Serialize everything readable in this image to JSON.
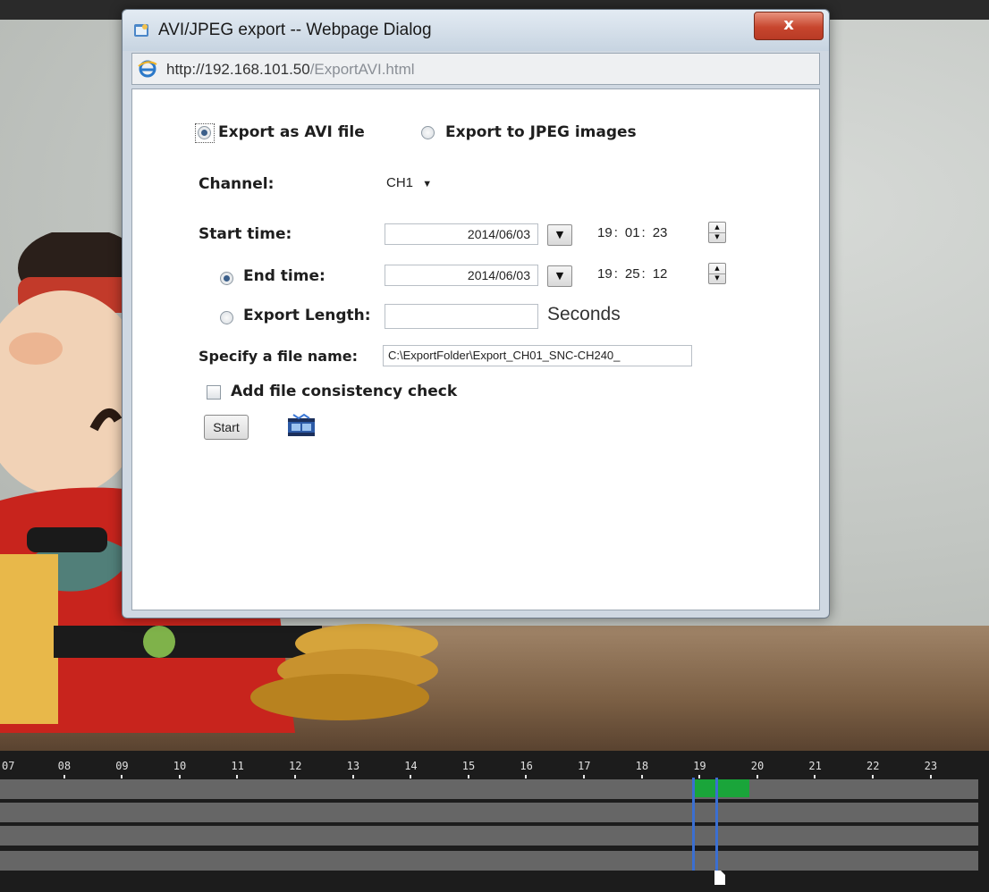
{
  "dialog": {
    "title": "AVI/JPEG export -- Webpage Dialog",
    "close_label": "x",
    "address": {
      "host": "http://192.168.101.50",
      "path": "/ExportAVI.html"
    }
  },
  "form": {
    "export_avi_label": "Export as AVI file",
    "export_jpeg_label": "Export to JPEG images",
    "export_mode": "avi",
    "channel_label": "Channel:",
    "channel_value": "CH1",
    "start_label": "Start time:",
    "start_date": "2014/06/03",
    "start_h": "19",
    "start_m": "01",
    "start_s": "23",
    "end_label": "End time:",
    "end_date": "2014/06/03",
    "end_h": "19",
    "end_m": "25",
    "end_s": "12",
    "length_label": "Export Length:",
    "length_value": "",
    "seconds_label": "Seconds",
    "filename_label": "Specify a file name:",
    "filename_value": "C:\\ExportFolder\\Export_CH01_SNC-CH240_",
    "consistency_label": "Add file consistency check",
    "start_button": "Start",
    "time_sep": ":"
  },
  "timeline": {
    "hours": [
      "07",
      "08",
      "09",
      "10",
      "11",
      "12",
      "13",
      "14",
      "15",
      "16",
      "17",
      "18",
      "19",
      "20",
      "21",
      "22",
      "23"
    ],
    "colors": {
      "track": "#666666",
      "record": "#1aa53a",
      "cursor": "#3b6fd1"
    }
  }
}
